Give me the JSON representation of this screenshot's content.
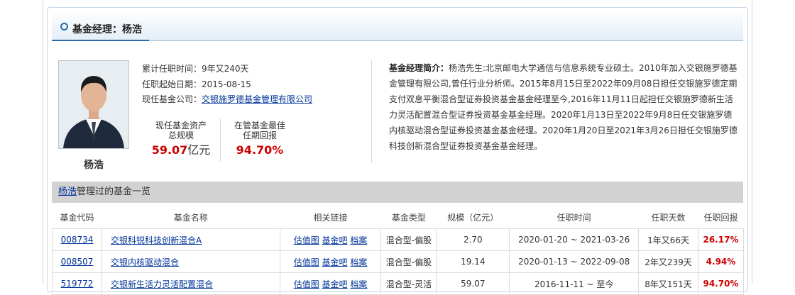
{
  "header": {
    "title": "基金经理：杨浩"
  },
  "manager": {
    "name": "杨浩",
    "tenure_label": "累计任职时间：",
    "tenure_value": "9年又240天",
    "start_label": "任职起始日期：",
    "start_value": "2015-08-15",
    "company_label": "现任基金公司：",
    "company_value": "交银施罗德基金管理有限公司",
    "stat_assets_label_1": "现任基金资产",
    "stat_assets_label_2": "总规模",
    "stat_assets_value": "59.07",
    "stat_assets_unit": "亿元",
    "stat_return_label_1": "在管基金最佳",
    "stat_return_label_2": "任期回报",
    "stat_return_value": "94.70%"
  },
  "intro": {
    "label": "基金经理简介：",
    "text": "杨浩先生:北京邮电大学通信与信息系统专业硕士。2010年加入交银施罗德基金管理有限公司,曾任行业分析师。2015年8月15日至2022年09月08日担任交银施罗德定期支付双息平衡混合型证券投资基金基金经理至今,2016年11月11日起担任交银施罗德新生活力灵活配置混合型证券投资基金基金经理。2020年1月13日至2022年9月8日任交银施罗德内核驱动混合型证券投资基金基金经理。2020年1月20日至2021年3月26日担任交银施罗德科技创新混合型证券投资基金基金经理。"
  },
  "fund_list": {
    "name_link": "杨浩",
    "title_suffix": "管理过的基金一览",
    "columns": [
      "基金代码",
      "基金名称",
      "相关链接",
      "基金类型",
      "规模（亿元）",
      "任职时间",
      "任职天数",
      "任职回报"
    ],
    "link_labels": [
      "估值图",
      "基金吧",
      "档案"
    ],
    "rows": [
      {
        "code": "008734",
        "name": "交银科锐科技创新混合A",
        "type": "混合型-偏股",
        "size": "2.70",
        "period": "2020-01-20 ~ 2021-03-26",
        "days": "1年又66天",
        "return": "26.17%"
      },
      {
        "code": "008507",
        "name": "交银内核驱动混合",
        "type": "混合型-偏股",
        "size": "19.14",
        "period": "2020-01-13 ~ 2022-09-08",
        "days": "2年又239天",
        "return": "4.94%"
      },
      {
        "code": "519772",
        "name": "交银新生活力灵活配置混合",
        "type": "混合型-灵活",
        "size": "59.07",
        "period": "2016-11-11 ~ 至今",
        "days": "8年又151天",
        "return": "94.70%"
      }
    ]
  },
  "colors": {
    "accent": "#2a6ca8",
    "return_red": "#cc0000",
    "link_blue": "#003399"
  }
}
